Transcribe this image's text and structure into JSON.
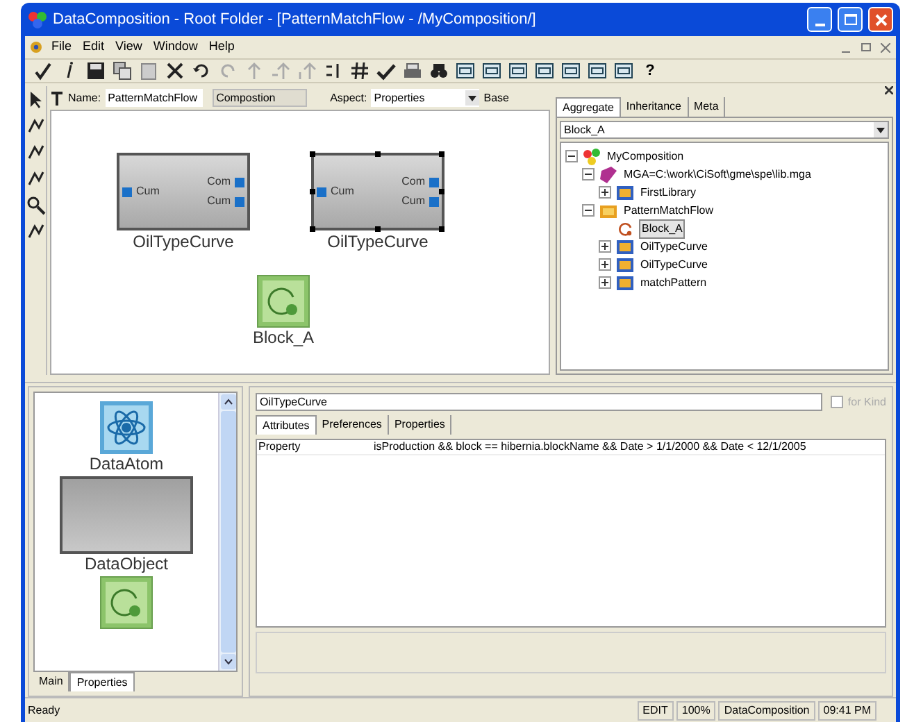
{
  "window": {
    "title": "DataComposition - Root Folder - [PatternMatchFlow - /MyComposition/]"
  },
  "menu": [
    {
      "label": "File"
    },
    {
      "label": "Edit"
    },
    {
      "label": "View"
    },
    {
      "label": "Window"
    },
    {
      "label": "Help"
    }
  ],
  "toolbar": {
    "help_label": "?"
  },
  "editor": {
    "name_label": "Name:",
    "name_value": "PatternMatchFlow",
    "kind_value": "Compostion",
    "aspect_label": "Aspect:",
    "aspect_value": "Properties",
    "base_label": "Base"
  },
  "canvas": {
    "nodes": [
      {
        "kind": "model",
        "label": "OilTypeCurve",
        "selected": false,
        "ports_left": [
          "Cum"
        ],
        "ports_right": [
          "Com",
          "Cum"
        ]
      },
      {
        "kind": "model",
        "label": "OilTypeCurve",
        "selected": true,
        "ports_left": [
          "Cum"
        ],
        "ports_right": [
          "Com",
          "Cum"
        ]
      },
      {
        "kind": "block",
        "label": "Block_A",
        "selected": false
      }
    ]
  },
  "browser": {
    "tabs": [
      {
        "label": "Aggregate",
        "selected": true
      },
      {
        "label": "Inheritance",
        "selected": false
      },
      {
        "label": "Meta",
        "selected": false
      }
    ],
    "combo_value": "Block_A",
    "tree": [
      {
        "label": "MyComposition",
        "kind": "root",
        "expanded": true,
        "children": [
          {
            "label": "MGA=C:\\work\\CiSoft\\gme\\spe\\lib.mga",
            "kind": "library",
            "expanded": true,
            "children": [
              {
                "label": "FirstLibrary",
                "kind": "model",
                "expanded": false
              }
            ]
          },
          {
            "label": "PatternMatchFlow",
            "kind": "folder",
            "expanded": true,
            "children": [
              {
                "label": "Block_A",
                "kind": "block",
                "selected": true
              },
              {
                "label": "OilTypeCurve",
                "kind": "model",
                "expanded": false
              },
              {
                "label": "OilTypeCurve",
                "kind": "model",
                "expanded": false
              },
              {
                "label": "matchPattern",
                "kind": "model",
                "expanded": false
              }
            ]
          }
        ]
      }
    ]
  },
  "parts": {
    "items": [
      {
        "kind": "atom",
        "label": "DataAtom"
      },
      {
        "kind": "model",
        "label": "DataObject"
      },
      {
        "kind": "block"
      }
    ],
    "tabs": [
      {
        "label": "Main",
        "selected": false
      },
      {
        "label": "Properties",
        "selected": true
      }
    ]
  },
  "attributes": {
    "name_value": "OilTypeCurve",
    "for_kind": {
      "label": "for Kind",
      "checked": false,
      "disabled": true
    },
    "tabs": [
      {
        "label": "Attributes",
        "selected": true
      },
      {
        "label": "Preferences",
        "selected": false
      },
      {
        "label": "Properties",
        "selected": false
      }
    ],
    "rows": [
      {
        "name": "Property",
        "value": "isProduction && block == hibernia.blockName && Date > 1/1/2000 && Date < 12/1/2005"
      }
    ]
  },
  "status_bar": {
    "message": "Ready",
    "panes": [
      "EDIT",
      "100%",
      "DataComposition",
      "09:41 PM"
    ]
  }
}
